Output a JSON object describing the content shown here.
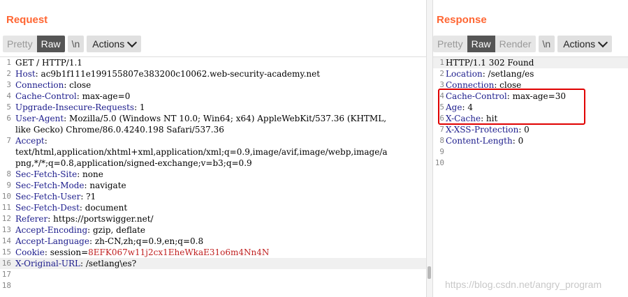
{
  "request": {
    "title": "Request",
    "buttons": [
      "Pretty",
      "Raw",
      "\\n",
      "Actions"
    ],
    "lines": [
      {
        "n": "1",
        "name": "",
        "sep": "",
        "value": "GET / HTTP/1.1"
      },
      {
        "n": "2",
        "name": "Host",
        "sep": ":",
        "value": " ac9b1f111e199155807e383200c10062.web-security-academy.net"
      },
      {
        "n": "3",
        "name": "Connection",
        "sep": ":",
        "value": " close"
      },
      {
        "n": "4",
        "name": "Cache-Control",
        "sep": ":",
        "value": " max-age=0"
      },
      {
        "n": "5",
        "name": "Upgrade-Insecure-Requests",
        "sep": ":",
        "value": " 1"
      },
      {
        "n": "6",
        "name": "User-Agent",
        "sep": ":",
        "value": " Mozilla/5.0 (Windows NT 10.0; Win64; x64) AppleWebKit/537.36 (KHTML,"
      },
      {
        "n": "",
        "name": "",
        "sep": "",
        "value": "like Gecko) Chrome/86.0.4240.198 Safari/537.36"
      },
      {
        "n": "7",
        "name": "Accept",
        "sep": ":",
        "value": ""
      },
      {
        "n": "",
        "name": "",
        "sep": "",
        "value": "text/html,application/xhtml+xml,application/xml;q=0.9,image/avif,image/webp,image/a"
      },
      {
        "n": "",
        "name": "",
        "sep": "",
        "value": "png,*/*;q=0.8,application/signed-exchange;v=b3;q=0.9"
      },
      {
        "n": "8",
        "name": "Sec-Fetch-Site",
        "sep": ":",
        "value": " none"
      },
      {
        "n": "9",
        "name": "Sec-Fetch-Mode",
        "sep": ":",
        "value": " navigate"
      },
      {
        "n": "10",
        "name": "Sec-Fetch-User",
        "sep": ":",
        "value": " ?1"
      },
      {
        "n": "11",
        "name": "Sec-Fetch-Dest",
        "sep": ":",
        "value": " document"
      },
      {
        "n": "12",
        "name": "Referer",
        "sep": ":",
        "value": " https://portswigger.net/"
      },
      {
        "n": "13",
        "name": "Accept-Encoding",
        "sep": ":",
        "value": " gzip, deflate"
      },
      {
        "n": "14",
        "name": "Accept-Language",
        "sep": ":",
        "value": " zh-CN,zh;q=0.9,en;q=0.8"
      },
      {
        "n": "15",
        "name": "Cookie",
        "sep": ":",
        "value": " session=",
        "cookie": "8EFK067w11j2cx1EheWkaE31o6m4Nn4N"
      },
      {
        "n": "16",
        "name": "X-Original-URL",
        "sep": ":",
        "value": " /setlang\\es?"
      },
      {
        "n": "17",
        "name": "",
        "sep": "",
        "value": ""
      },
      {
        "n": "18",
        "name": "",
        "sep": "",
        "value": ""
      }
    ]
  },
  "response": {
    "title": "Response",
    "buttons": [
      "Pretty",
      "Raw",
      "Render",
      "\\n",
      "Actions"
    ],
    "lines": [
      {
        "n": "1",
        "name": "",
        "sep": "",
        "value": "HTTP/1.1 302 Found"
      },
      {
        "n": "2",
        "name": "Location",
        "sep": ":",
        "value": " /setlang/es"
      },
      {
        "n": "3",
        "name": "Connection",
        "sep": ":",
        "value": " close"
      },
      {
        "n": "4",
        "name": "Cache-Control",
        "sep": ":",
        "value": " max-age=30"
      },
      {
        "n": "5",
        "name": "Age",
        "sep": ":",
        "value": " 4"
      },
      {
        "n": "6",
        "name": "X-Cache",
        "sep": ":",
        "value": " hit"
      },
      {
        "n": "7",
        "name": "X-XSS-Protection",
        "sep": ":",
        "value": " 0"
      },
      {
        "n": "8",
        "name": "Content-Length",
        "sep": ":",
        "value": " 0"
      },
      {
        "n": "9",
        "name": "",
        "sep": "",
        "value": ""
      },
      {
        "n": "10",
        "name": "",
        "sep": "",
        "value": ""
      }
    ]
  },
  "watermark": "https://blog.csdn.net/angry_program",
  "colors": {
    "accent": "#ff6633",
    "highlight_box": "#e00000",
    "header_name": "#1c1c8c",
    "cookie_value": "#c02020"
  }
}
